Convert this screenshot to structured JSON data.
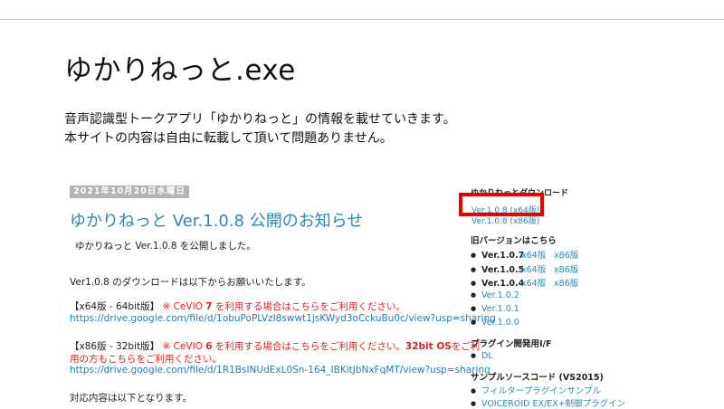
{
  "header": {
    "site_title": "ゆかりねっと.exe",
    "description_line1": "音声認識型トークアプリ「ゆかりねっと」の情報を載せていきます。",
    "description_line2": "本サイトの内容は自由に転載して頂いて問題ありません。"
  },
  "post": {
    "date": "2021年10月20日水曜日",
    "title": "ゆかりねっと Ver.1.0.8 公開のお知らせ",
    "intro": "ゆかりねっと Ver.1.0.8 を公開しました。",
    "download_text": "Ver1.0.8 のダウンロードは以下からお願いいたします。",
    "x64": {
      "label": "【x64版 - 64bit版】",
      "note_prefix": "※ CeVIO ",
      "note_num": "7",
      "note_suffix": " を利用する場合はこちらをご利用ください。",
      "url": "https://drive.google.com/file/d/1obuPoPLVzI8swwt1jsKWyd3oCckuBu0c/view?usp=sharing"
    },
    "x86": {
      "label": "【x86版 - 32bit版】",
      "note_prefix": "※ CeVIO ",
      "note_num": "6",
      "note_mid": " を利用する場合はこちらをご利用ください。",
      "note_bits": "32bit OS",
      "note_end1": "をご利",
      "note_end2": "用の方もこちらをご利用ください。",
      "url": "https://drive.google.com/file/d/1R1BsINUdExL0Sn-164_IBKitJbNxFqMT/view?usp=sharing"
    },
    "contents_text": "対応内容は以下となります。"
  },
  "sidebar": {
    "download_heading": "ゆかりねっとダウンロード",
    "download_link": "Ver.1.0.8 (x64版)",
    "download_link2": "Ver.1.0.8 (x86版)",
    "old_heading": "旧バージョンはこちら",
    "old_versions": [
      {
        "ver": "Ver.1.0.7",
        "x64": "x64版",
        "x86": "x86版"
      },
      {
        "ver": "Ver.1.0.5",
        "x64": "x64版",
        "x86": "x86版"
      },
      {
        "ver": "Ver.1.0.4",
        "x64": "x64版",
        "x86": "x86版"
      },
      {
        "ver": "",
        "link": "Ver.1.0.2"
      },
      {
        "ver": "",
        "link": "Ver.1.0.1"
      },
      {
        "ver": "",
        "link": "Ver.1.0.0"
      }
    ],
    "plugin_heading": "プラグイン開発用I/F",
    "plugin_link": "DL",
    "sample_heading": "サンプルソースコード (VS2015)",
    "sample_links": [
      "フィルタープラグインサンプル",
      "VOICEROID EX/EX+制御プラグイン"
    ]
  }
}
